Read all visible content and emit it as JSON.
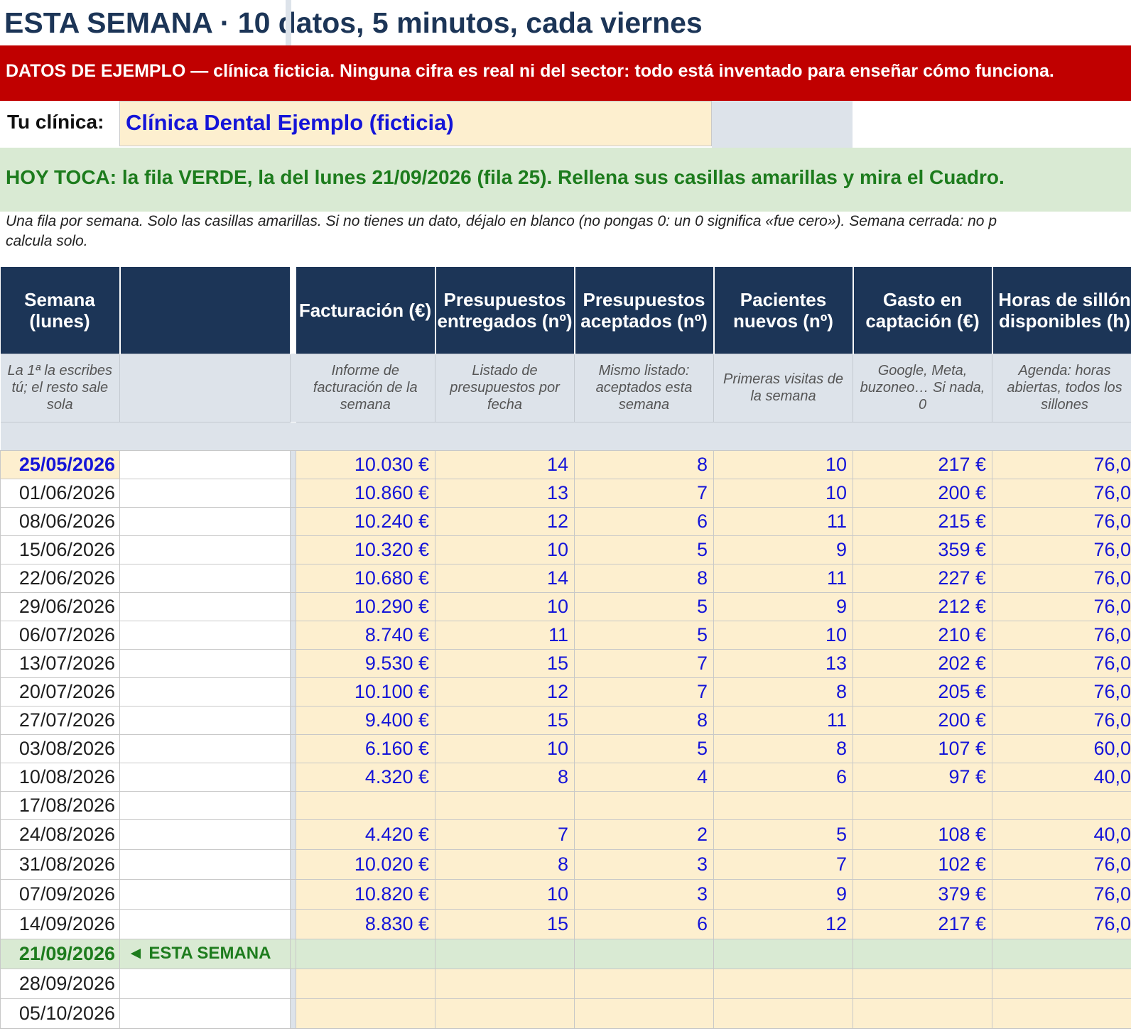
{
  "title": "ESTA SEMANA · 10 datos, 5 minutos, cada viernes",
  "banner": "DATOS DE EJEMPLO — clínica ficticia. Ninguna cifra es real ni del sector: todo está inventado para enseñar cómo funciona.",
  "clinic": {
    "label": "Tu clínica:",
    "name": "Clínica Dental Ejemplo (ficticia)"
  },
  "today": "HOY TOCA: la fila VERDE, la del lunes 21/09/2026 (fila 25). Rellena sus casillas amarillas y mira el Cuadro.",
  "note": {
    "line1": "Una fila por semana. Solo las casillas amarillas. Si no tienes un dato, déjalo en blanco (no pongas 0: un 0 significa «fue cero»). Semana cerrada: no p",
    "line2": "calcula solo."
  },
  "table": {
    "headers": [
      "Semana (lunes)",
      "",
      "Facturación (€)",
      "Presupuestos entregados (nº)",
      "Presupuestos aceptados (nº)",
      "Pacientes nuevos (nº)",
      "Gasto en captación (€)",
      "Horas de sillón disponibles (h)"
    ],
    "hints": [
      "La 1ª la escribes tú; el resto sale sola",
      "",
      "Informe de facturación de la semana",
      "Listado de presupuestos por fecha",
      "Mismo listado: aceptados esta semana",
      "Primeras visitas de la semana",
      "Google, Meta, buzoneo… Si nada, 0",
      "Agenda: horas abiertas, todos los sillones"
    ],
    "current_marker": "◄ ESTA SEMANA",
    "rows": [
      {
        "date": "25/05/2026",
        "f": "10.030 €",
        "pe": "14",
        "pa": "8",
        "pn": "10",
        "g": "217 €",
        "h": "76,0"
      },
      {
        "date": "01/06/2026",
        "f": "10.860 €",
        "pe": "13",
        "pa": "7",
        "pn": "10",
        "g": "200 €",
        "h": "76,0"
      },
      {
        "date": "08/06/2026",
        "f": "10.240 €",
        "pe": "12",
        "pa": "6",
        "pn": "11",
        "g": "215 €",
        "h": "76,0"
      },
      {
        "date": "15/06/2026",
        "f": "10.320 €",
        "pe": "10",
        "pa": "5",
        "pn": "9",
        "g": "359 €",
        "h": "76,0"
      },
      {
        "date": "22/06/2026",
        "f": "10.680 €",
        "pe": "14",
        "pa": "8",
        "pn": "11",
        "g": "227 €",
        "h": "76,0"
      },
      {
        "date": "29/06/2026",
        "f": "10.290 €",
        "pe": "10",
        "pa": "5",
        "pn": "9",
        "g": "212 €",
        "h": "76,0"
      },
      {
        "date": "06/07/2026",
        "f": "8.740 €",
        "pe": "11",
        "pa": "5",
        "pn": "10",
        "g": "210 €",
        "h": "76,0"
      },
      {
        "date": "13/07/2026",
        "f": "9.530 €",
        "pe": "15",
        "pa": "7",
        "pn": "13",
        "g": "202 €",
        "h": "76,0"
      },
      {
        "date": "20/07/2026",
        "f": "10.100 €",
        "pe": "12",
        "pa": "7",
        "pn": "8",
        "g": "205 €",
        "h": "76,0"
      },
      {
        "date": "27/07/2026",
        "f": "9.400 €",
        "pe": "15",
        "pa": "8",
        "pn": "11",
        "g": "200 €",
        "h": "76,0"
      },
      {
        "date": "03/08/2026",
        "f": "6.160 €",
        "pe": "10",
        "pa": "5",
        "pn": "8",
        "g": "107 €",
        "h": "60,0"
      },
      {
        "date": "10/08/2026",
        "f": "4.320 €",
        "pe": "8",
        "pa": "4",
        "pn": "6",
        "g": "97 €",
        "h": "40,0"
      },
      {
        "date": "17/08/2026",
        "f": "",
        "pe": "",
        "pa": "",
        "pn": "",
        "g": "",
        "h": ""
      },
      {
        "date": "24/08/2026",
        "f": "4.420 €",
        "pe": "7",
        "pa": "2",
        "pn": "5",
        "g": "108 €",
        "h": "40,0"
      },
      {
        "date": "31/08/2026",
        "f": "10.020 €",
        "pe": "8",
        "pa": "3",
        "pn": "7",
        "g": "102 €",
        "h": "76,0"
      },
      {
        "date": "07/09/2026",
        "f": "10.820 €",
        "pe": "10",
        "pa": "3",
        "pn": "9",
        "g": "379 €",
        "h": "76,0"
      },
      {
        "date": "14/09/2026",
        "f": "8.830 €",
        "pe": "15",
        "pa": "6",
        "pn": "12",
        "g": "217 €",
        "h": "76,0"
      },
      {
        "date": "21/09/2026",
        "f": "",
        "pe": "",
        "pa": "",
        "pn": "",
        "g": "",
        "h": ""
      },
      {
        "date": "28/09/2026",
        "f": "",
        "pe": "",
        "pa": "",
        "pn": "",
        "g": "",
        "h": ""
      },
      {
        "date": "05/10/2026",
        "f": "",
        "pe": "",
        "pa": "",
        "pn": "",
        "g": "",
        "h": ""
      }
    ]
  }
}
